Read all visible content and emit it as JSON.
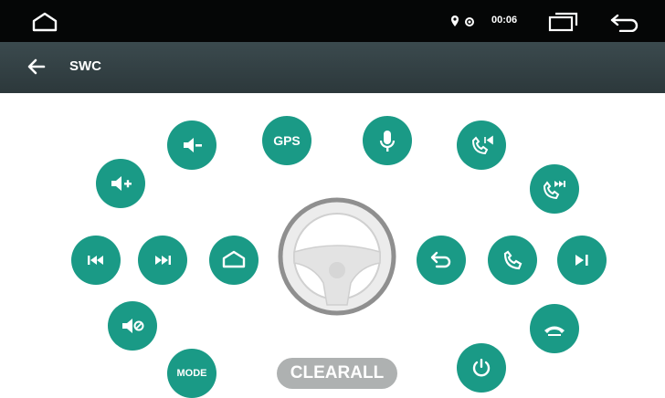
{
  "status_bar": {
    "time": "00:06",
    "icons": [
      "home-outline-icon",
      "location-pin-icon",
      "settings-small-icon",
      "recent-apps-icon",
      "back-arrow-icon"
    ]
  },
  "header": {
    "title": "SWC",
    "back_icon": "left-arrow-icon"
  },
  "swc": {
    "gps_label": "GPS",
    "mode_label": "MODE",
    "clear_all_label": "CLEARALL",
    "button_color": "#1a9a86",
    "wheel_color": "#e3e3e3",
    "clear_color": "#aeb1b1",
    "buttons": [
      "volume-down-icon",
      "gps-button",
      "microphone-icon",
      "call-previous-icon",
      "volume-up-icon",
      "call-next-icon",
      "previous-track-icon",
      "next-track-icon",
      "home-icon",
      "back-icon",
      "phone-icon",
      "play-pause-icon",
      "mute-icon",
      "mode-button",
      "power-icon",
      "hang-up-icon"
    ]
  }
}
